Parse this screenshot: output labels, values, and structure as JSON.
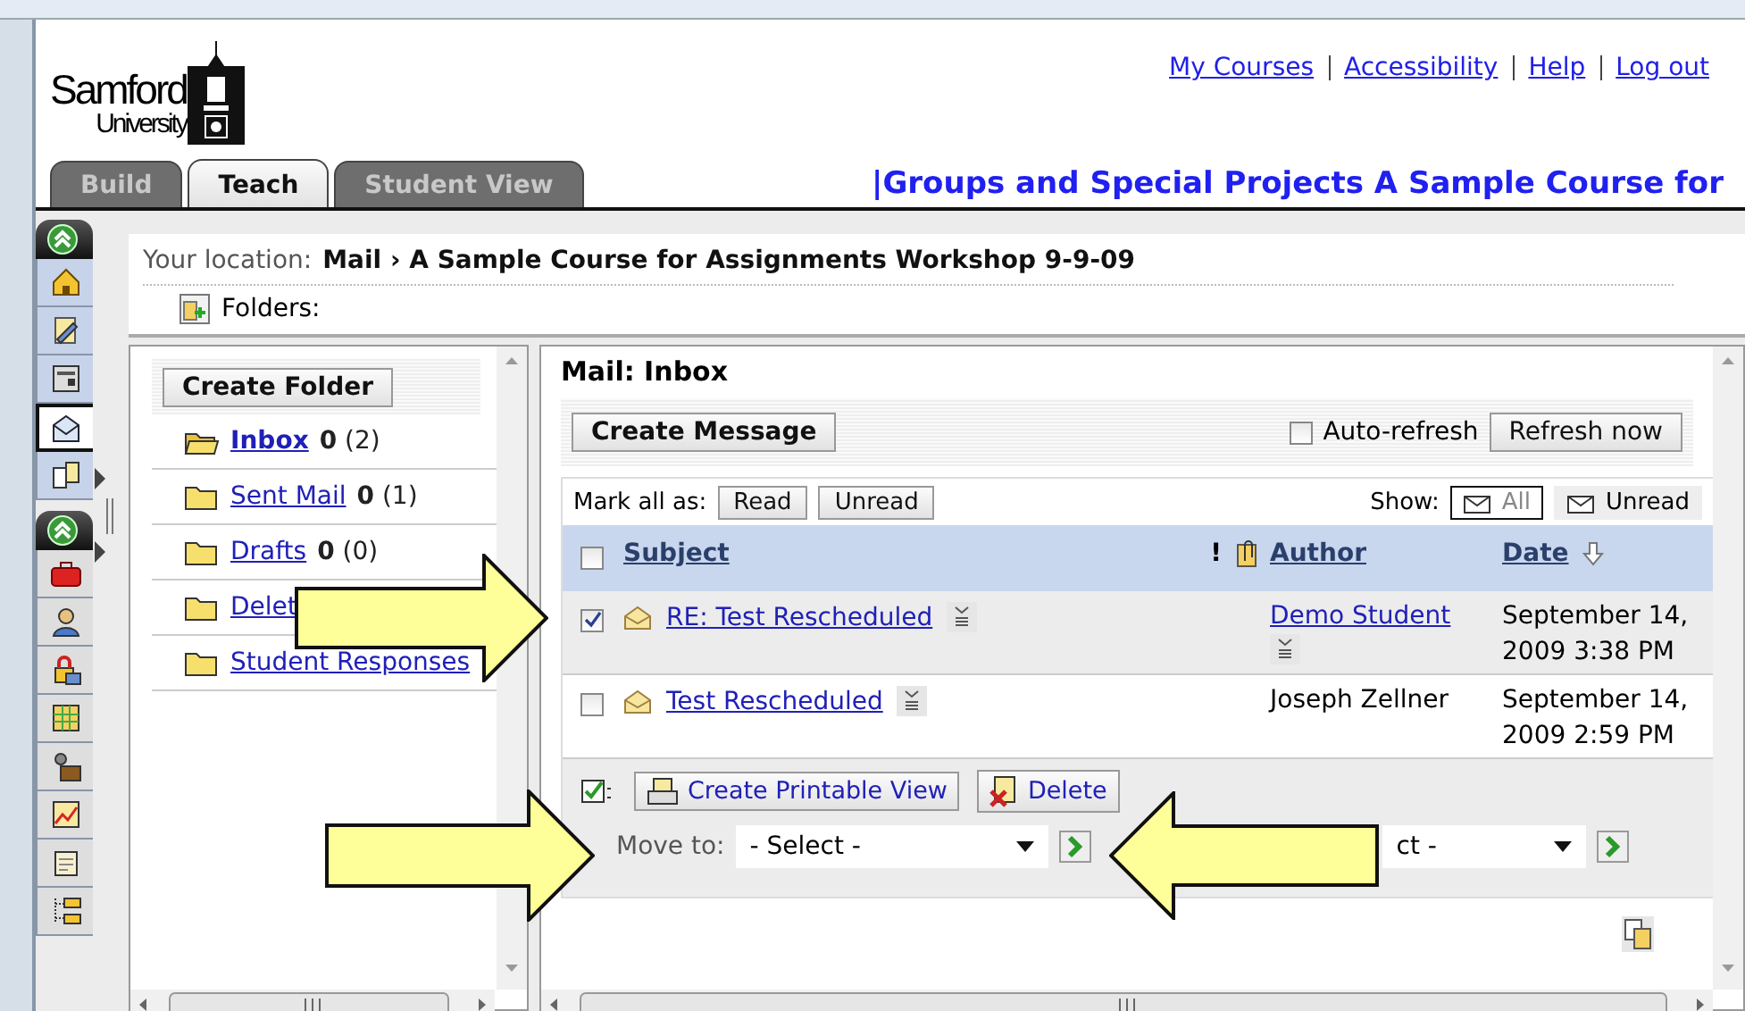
{
  "header": {
    "logo": {
      "name": "Samford",
      "subtitle": "University"
    },
    "links": [
      "My Courses",
      "Accessibility",
      "Help",
      "Log out"
    ],
    "tabs": [
      {
        "label": "Build",
        "selected": false
      },
      {
        "label": "Teach",
        "selected": true
      },
      {
        "label": "Student View",
        "selected": false
      }
    ],
    "course_title": "|Groups and Special Projects A Sample Course for"
  },
  "tool_groups": [
    {
      "items": [
        {
          "selected": false
        },
        {
          "selected": false
        },
        {
          "selected": false
        },
        {
          "selected": true
        },
        {
          "selected": false
        }
      ]
    },
    {
      "items": [
        {
          "selected": false
        },
        {
          "selected": false
        },
        {
          "selected": false
        },
        {
          "selected": false
        },
        {
          "selected": false
        },
        {
          "selected": false
        },
        {
          "selected": false
        },
        {
          "selected": false
        }
      ]
    }
  ],
  "location": {
    "label": "Your location:",
    "path": "Mail › A Sample Course for Assignments Workshop 9-9-09"
  },
  "folders_label": "Folders:",
  "folders": {
    "create_button": "Create Folder",
    "items": [
      {
        "name": "Inbox",
        "unread": "0",
        "total": "(2)",
        "selected": true
      },
      {
        "name": "Sent Mail",
        "unread": "0",
        "total": "(1)",
        "selected": false
      },
      {
        "name": "Drafts",
        "unread": "0",
        "total": "(0)",
        "selected": false
      },
      {
        "name": "Delet",
        "selected": false
      },
      {
        "name": "Student Responses",
        "selected": false
      }
    ]
  },
  "mail": {
    "title": "Mail: Inbox",
    "create_button": "Create Message",
    "auto_refresh": {
      "label": "Auto-refresh",
      "checked": false
    },
    "refresh_button": "Refresh now",
    "mark_all": {
      "label": "Mark all as:",
      "buttons": [
        "Read",
        "Unread"
      ]
    },
    "show": {
      "label": "Show:",
      "filters": [
        {
          "label": "All",
          "selected": true
        },
        {
          "label": "Unread",
          "selected": false
        }
      ]
    },
    "select_all_checked": false,
    "columns": {
      "subject": "Subject",
      "priority": "!",
      "author": "Author",
      "date": "Date"
    },
    "rows": [
      {
        "checked": true,
        "subject": "RE: Test Rescheduled",
        "author": "Demo Student",
        "author_link": true,
        "date": "September 14, 2009 3:38 PM"
      },
      {
        "checked": false,
        "subject": "Test Rescheduled",
        "author": "Joseph Zellner",
        "author_link": false,
        "date": "September 14, 2009 2:59 PM"
      }
    ],
    "actions": {
      "printable_button": "Create Printable View",
      "delete_button": "Delete",
      "move_label": "Move to:",
      "selects": [
        "- Select -",
        "ct -"
      ]
    }
  },
  "callout_arrows": [
    {
      "points_left": false
    },
    {
      "points_left": false
    },
    {
      "points_left": true
    }
  ]
}
